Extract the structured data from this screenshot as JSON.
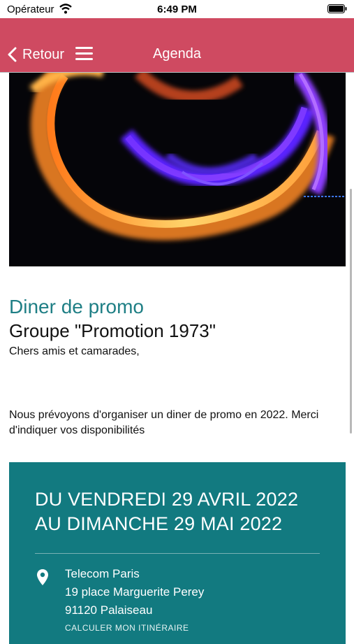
{
  "status": {
    "carrier": "Opérateur",
    "time": "6:49 PM"
  },
  "nav": {
    "back_label": "Retour",
    "title": "Agenda"
  },
  "event": {
    "category": "Diner de promo",
    "title": "Groupe \"Promotion 1973\"",
    "greeting": "Chers amis et camarades,",
    "description": "Nous prévoyons d'organiser un diner de promo en 2022. Merci d'indiquer vos disponibilités"
  },
  "dates": {
    "line1": "DU VENDREDI 29 AVRIL 2022",
    "line2": "AU DIMANCHE 29 MAI 2022"
  },
  "location": {
    "name": "Telecom Paris",
    "street": "19 place Marguerite Perey",
    "city": "91120 Palaiseau"
  },
  "route_label": "CALCULER MON ITINÉRAIRE",
  "colors": {
    "nav": "#cf4a61",
    "panel": "#127a80",
    "category": "#1f7f85"
  },
  "icons": [
    "wifi-icon",
    "battery-icon",
    "back-chevron-icon",
    "menu-icon",
    "location-pin-icon"
  ]
}
